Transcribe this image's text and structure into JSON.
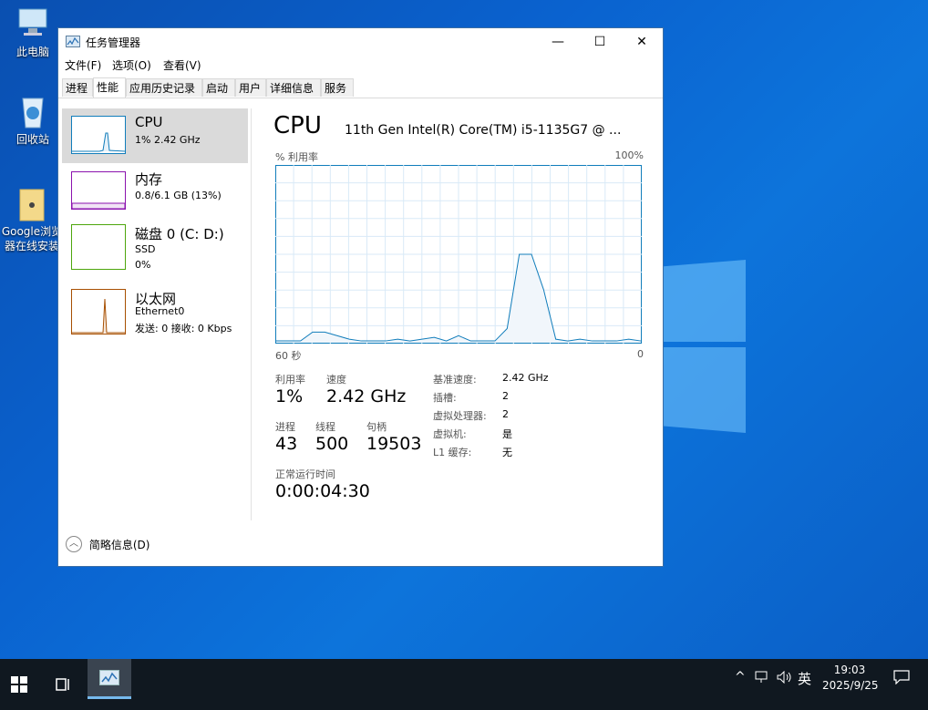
{
  "desktop": {
    "icons": [
      {
        "label": "此电脑",
        "icon": "computer-icon"
      },
      {
        "label": "回收站",
        "icon": "recycle-bin-icon"
      },
      {
        "label": "Google浏览器在线安装",
        "icon": "folder-icon"
      }
    ]
  },
  "window": {
    "title": "任务管理器",
    "controls": {
      "minimize": "—",
      "maximize": "☐",
      "close": "✕"
    },
    "menu": [
      "文件(F)",
      "选项(O)",
      "查看(V)"
    ],
    "tabs": [
      "进程",
      "性能",
      "应用历史记录",
      "启动",
      "用户",
      "详细信息",
      "服务"
    ],
    "active_tab": "性能",
    "sidebar": [
      {
        "name": "CPU",
        "sub1": "1% 2.42 GHz",
        "sub2": "",
        "color": "#117dbb"
      },
      {
        "name": "内存",
        "sub1": "0.8/6.1 GB (13%)",
        "sub2": "",
        "color": "#8b12ae"
      },
      {
        "name": "磁盘 0 (C: D:)",
        "sub1": "SSD",
        "sub2": "0%",
        "color": "#4da60c"
      },
      {
        "name": "以太网",
        "sub1": "Ethernet0",
        "sub2": "发送: 0 接收: 0 Kbps",
        "color": "#a74f01"
      }
    ],
    "main": {
      "heading": "CPU",
      "model": "11th Gen Intel(R) Core(TM) i5-1135G7 @ ...",
      "graph_top_left": "% 利用率",
      "graph_top_right": "100%",
      "graph_bottom_left": "60 秒",
      "graph_bottom_right": "0",
      "stats": {
        "util_label": "利用率",
        "util_value": "1%",
        "speed_label": "速度",
        "speed_value": "2.42 GHz",
        "proc_label": "进程",
        "proc_value": "43",
        "thread_label": "线程",
        "thread_value": "500",
        "handle_label": "句柄",
        "handle_value": "19503",
        "uptime_label": "正常运行时间",
        "uptime_value": "0:00:04:30"
      },
      "specs": [
        {
          "k": "基准速度:",
          "v": "2.42 GHz"
        },
        {
          "k": "插槽:",
          "v": "2"
        },
        {
          "k": "虚拟处理器:",
          "v": "2"
        },
        {
          "k": "虚拟机:",
          "v": "是"
        },
        {
          "k": "L1 缓存:",
          "v": "无"
        }
      ]
    },
    "footer": "简略信息(D)"
  },
  "chart_data": {
    "type": "area",
    "x": [
      60,
      58,
      56,
      54,
      52,
      50,
      48,
      46,
      44,
      42,
      40,
      38,
      36,
      34,
      32,
      30,
      28,
      26,
      24,
      22,
      20,
      18,
      16,
      14,
      12,
      10,
      8,
      6,
      4,
      2,
      0
    ],
    "values": [
      1,
      1,
      1,
      6,
      6,
      4,
      2,
      1,
      1,
      1,
      2,
      1,
      2,
      3,
      1,
      4,
      1,
      1,
      1,
      8,
      50,
      50,
      30,
      2,
      1,
      2,
      1,
      1,
      1,
      2,
      1
    ],
    "ylim": [
      0,
      100
    ],
    "color": "#117dbb"
  },
  "taskbar": {
    "time": "19:03",
    "date": "2025/9/25",
    "ime": "英"
  }
}
